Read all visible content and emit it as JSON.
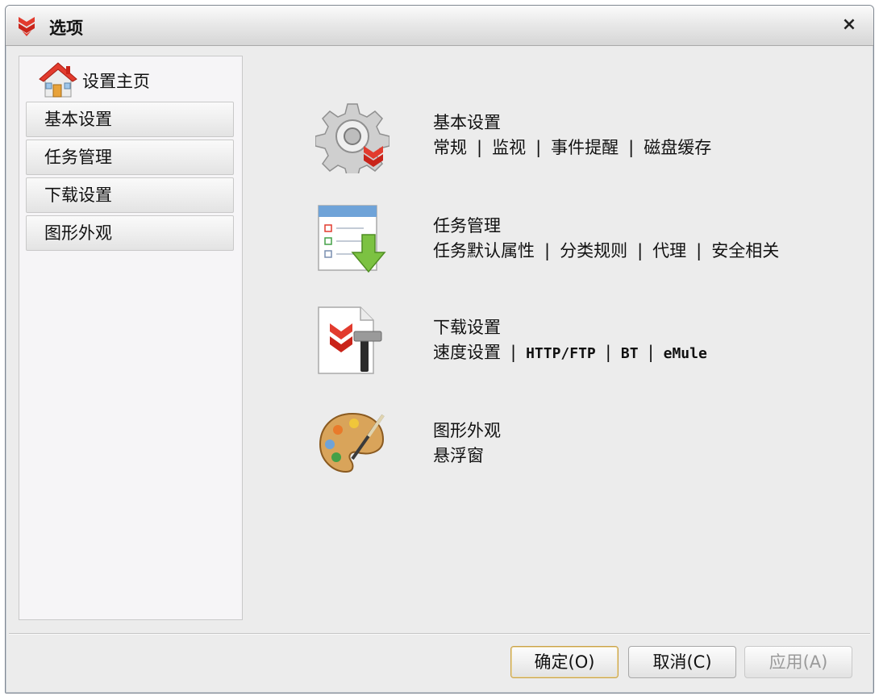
{
  "window": {
    "title": "选项",
    "close_symbol": "×"
  },
  "sidebar": {
    "home_label": "设置主页",
    "items": [
      {
        "label": "基本设置"
      },
      {
        "label": "任务管理"
      },
      {
        "label": "下载设置"
      },
      {
        "label": "图形外观"
      }
    ]
  },
  "sections": [
    {
      "title": "基本设置",
      "icon": "gear-icon",
      "links": [
        "常规",
        "监视",
        "事件提醒",
        "磁盘缓存"
      ]
    },
    {
      "title": "任务管理",
      "icon": "task-list-download-icon",
      "links": [
        "任务默认属性",
        "分类规则",
        "代理",
        "安全相关"
      ]
    },
    {
      "title": "下载设置",
      "icon": "download-tools-icon",
      "links": [
        "速度设置",
        "HTTP/FTP",
        "BT",
        "eMule"
      ]
    },
    {
      "title": "图形外观",
      "icon": "palette-icon",
      "links": [
        "悬浮窗"
      ]
    }
  ],
  "separator": "|",
  "buttons": {
    "ok": "确定(O)",
    "cancel": "取消(C)",
    "apply": "应用(A)"
  },
  "colors": {
    "accent_red": "#e23b2e",
    "arrow_green": "#7cc242",
    "default_button_border": "#c9a24a"
  }
}
